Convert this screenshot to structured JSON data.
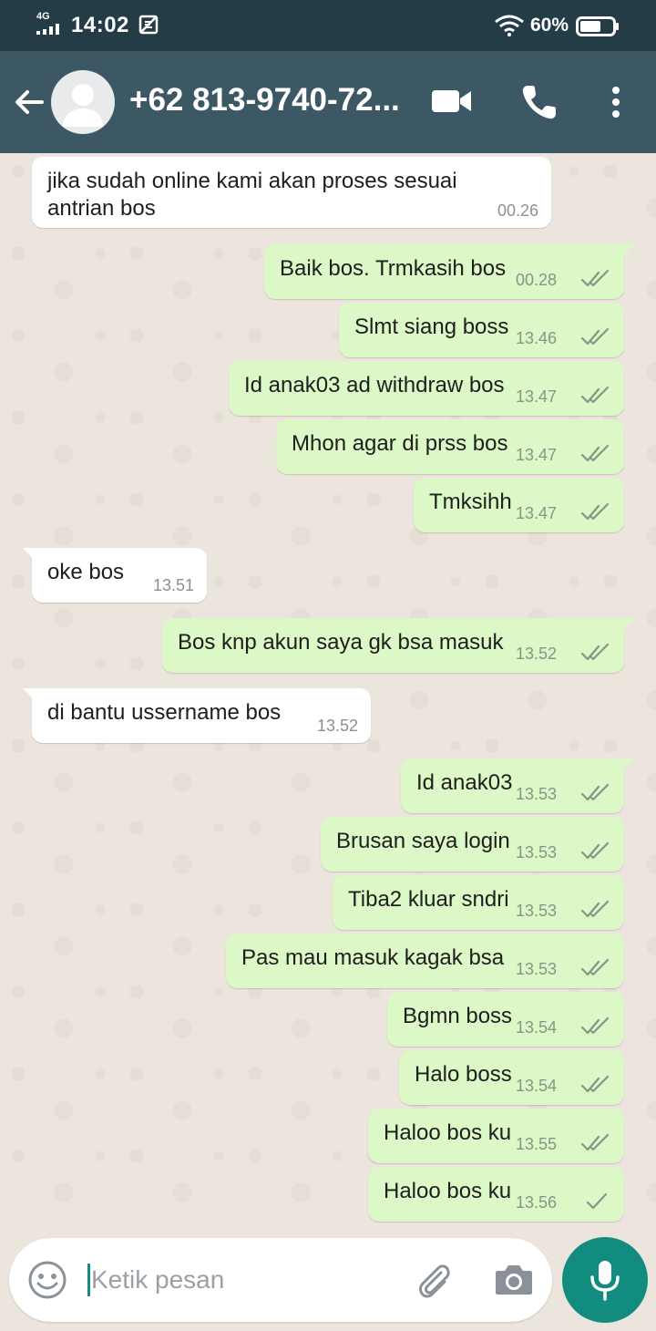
{
  "status_bar": {
    "network": "4G",
    "time": "14:02",
    "battery": "60%"
  },
  "app_bar": {
    "contact": "+62 813-9740-72..."
  },
  "messages": [
    {
      "dir": "in",
      "lines": [
        "jika sudah online kami akan proses sesuai",
        "antrian bos"
      ],
      "time": "00.26"
    },
    {
      "dir": "out",
      "lines": [
        "Baik bos. Trmkasih bos"
      ],
      "time": "00.28",
      "status": "read"
    },
    {
      "dir": "out",
      "lines": [
        "Slmt siang boss"
      ],
      "time": "13.46",
      "status": "read"
    },
    {
      "dir": "out",
      "lines": [
        "Id anak03 ad withdraw bos"
      ],
      "time": "13.47",
      "status": "read"
    },
    {
      "dir": "out",
      "lines": [
        "Mhon agar di prss bos"
      ],
      "time": "13.47",
      "status": "read"
    },
    {
      "dir": "out",
      "lines": [
        "Tmksihh"
      ],
      "time": "13.47",
      "status": "read"
    },
    {
      "dir": "in",
      "lines": [
        "oke bos"
      ],
      "time": "13.51"
    },
    {
      "dir": "out",
      "lines": [
        "Bos knp akun saya gk bsa masuk"
      ],
      "time": "13.52",
      "status": "read"
    },
    {
      "dir": "in",
      "lines": [
        "di bantu ussername bos"
      ],
      "time": "13.52"
    },
    {
      "dir": "out",
      "lines": [
        "Id anak03"
      ],
      "time": "13.53",
      "status": "read"
    },
    {
      "dir": "out",
      "lines": [
        "Brusan saya login"
      ],
      "time": "13.53",
      "status": "read"
    },
    {
      "dir": "out",
      "lines": [
        "Tiba2 kluar sndri"
      ],
      "time": "13.53",
      "status": "read"
    },
    {
      "dir": "out",
      "lines": [
        "Pas mau masuk kagak bsa"
      ],
      "time": "13.53",
      "status": "read"
    },
    {
      "dir": "out",
      "lines": [
        "Bgmn boss"
      ],
      "time": "13.54",
      "status": "read"
    },
    {
      "dir": "out",
      "lines": [
        "Halo boss"
      ],
      "time": "13.54",
      "status": "read"
    },
    {
      "dir": "out",
      "lines": [
        "Haloo bos ku"
      ],
      "time": "13.55",
      "status": "read"
    },
    {
      "dir": "out",
      "lines": [
        "Haloo bos ku"
      ],
      "time": "13.56",
      "status": "sent"
    }
  ],
  "composer": {
    "placeholder": "Ketik pesan"
  },
  "colors": {
    "header": "#3d5865",
    "status_bar": "#233c46",
    "outgoing_bubble": "#dcf8c6",
    "incoming_bubble": "#ffffff",
    "accent": "#128c7e"
  },
  "icons": [
    "back-arrow-icon",
    "avatar-placeholder-icon",
    "video-call-icon",
    "voice-call-icon",
    "more-options-icon",
    "double-check-icon",
    "single-check-icon",
    "emoji-icon",
    "attach-icon",
    "camera-icon",
    "mic-icon"
  ]
}
